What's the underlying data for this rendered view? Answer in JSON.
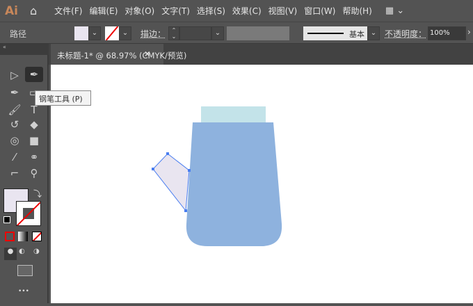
{
  "app": {
    "logo": "Ai"
  },
  "menu": [
    "文件(F)",
    "编辑(E)",
    "对象(O)",
    "文字(T)",
    "选择(S)",
    "效果(C)",
    "视图(V)",
    "窗口(W)",
    "帮助(H)"
  ],
  "control": {
    "selection_label": "路径",
    "stroke_label": "描边：",
    "brush_label": "基本",
    "opacity_label": "不透明度：",
    "opacity_value": "100%"
  },
  "document_tab": {
    "title": "未标题-1* @ 68.97% (CMYK/预览)",
    "close": "×"
  },
  "tooltip": "钢笔工具 (P)",
  "toolbar": {
    "more": "•••"
  },
  "colors": {
    "fill": "#e9e5f0",
    "lid": "#c3e3e9",
    "body": "#8eb2de",
    "selection": "#4a7ef0"
  }
}
